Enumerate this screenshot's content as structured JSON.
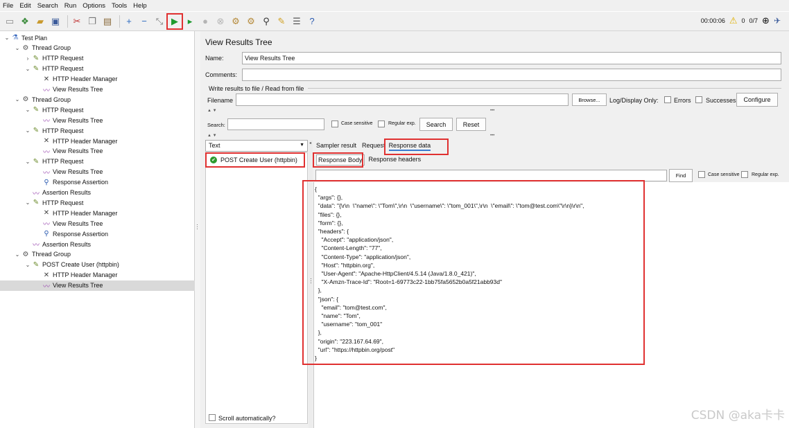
{
  "menu": [
    "File",
    "Edit",
    "Search",
    "Run",
    "Options",
    "Tools",
    "Help"
  ],
  "toolbar": {
    "timer": "00:00:06",
    "warnings": "0",
    "threads": "0/7",
    "icons": [
      "new-icon",
      "templates-icon",
      "open-icon",
      "save-icon",
      "cut-icon",
      "copy-icon",
      "paste-icon",
      "expand-icon",
      "collapse-icon",
      "toggle-icon",
      "start-icon",
      "start-no-pause-icon",
      "stop-icon",
      "shutdown-icon",
      "clear-icon",
      "clear-all-icon",
      "search-icon",
      "reset-search-icon",
      "function-helper-icon",
      "help-icon"
    ]
  },
  "tree": [
    {
      "label": "Test Plan",
      "icon": "test-plan-icon",
      "arrow": "v"
    },
    {
      "label": "Thread Group",
      "icon": "gear-icon",
      "arrow": "v"
    },
    {
      "label": "HTTP Request",
      "icon": "pipette-icon",
      "arrow": ">"
    },
    {
      "label": "HTTP Request",
      "icon": "pipette-icon",
      "arrow": "v"
    },
    {
      "label": "HTTP Header Manager",
      "icon": "tools-icon",
      "arrow": ""
    },
    {
      "label": "View Results Tree",
      "icon": "graph-icon",
      "arrow": ""
    },
    {
      "label": "Thread Group",
      "icon": "gear-icon",
      "arrow": "v"
    },
    {
      "label": "HTTP Request",
      "icon": "pipette-icon",
      "arrow": "v"
    },
    {
      "label": "View Results Tree",
      "icon": "graph-icon",
      "arrow": ""
    },
    {
      "label": "HTTP Request",
      "icon": "pipette-icon",
      "arrow": "v"
    },
    {
      "label": "HTTP Header Manager",
      "icon": "tools-icon",
      "arrow": ""
    },
    {
      "label": "View Results Tree",
      "icon": "graph-icon",
      "arrow": ""
    },
    {
      "label": "HTTP Request",
      "icon": "pipette-icon",
      "arrow": "v"
    },
    {
      "label": "View Results Tree",
      "icon": "graph-icon",
      "arrow": ""
    },
    {
      "label": "Response Assertion",
      "icon": "magnifier-icon",
      "arrow": ""
    },
    {
      "label": "Assertion Results",
      "icon": "graph-icon",
      "arrow": ""
    },
    {
      "label": "HTTP Request",
      "icon": "pipette-icon",
      "arrow": "v"
    },
    {
      "label": "HTTP Header Manager",
      "icon": "tools-icon",
      "arrow": ""
    },
    {
      "label": "View Results Tree",
      "icon": "graph-icon",
      "arrow": ""
    },
    {
      "label": "Response Assertion",
      "icon": "magnifier-icon",
      "arrow": ""
    },
    {
      "label": "Assertion Results",
      "icon": "graph-icon",
      "arrow": ""
    },
    {
      "label": "Thread Group",
      "icon": "gear-icon",
      "arrow": "v"
    },
    {
      "label": "POST Create User (httpbin)",
      "icon": "pipette-icon",
      "arrow": "v"
    },
    {
      "label": "HTTP Header Manager",
      "icon": "tools-icon",
      "arrow": ""
    },
    {
      "label": "View Results Tree",
      "icon": "graph-icon",
      "arrow": "",
      "selected": true
    }
  ],
  "panel": {
    "title": "View Results Tree",
    "name_label": "Name:",
    "name_value": "View Results Tree",
    "comments_label": "Comments:",
    "comments_value": "",
    "write_results": "Write results to file / Read from file",
    "filename_label": "Filename",
    "filename_value": "",
    "browse": "Browse...",
    "log_display": "Log/Display Only:",
    "errors": "Errors",
    "successes": "Successes",
    "configure": "Configure",
    "search_label": "Search:",
    "search_value": "",
    "case_sensitive": "Case sensitive",
    "regular_exp": "Regular exp.",
    "search_btn": "Search",
    "reset_btn": "Reset",
    "renderer": "Text",
    "result_item": "POST Create User (httpbin)",
    "tab_sampler": "Sampler result",
    "tab_request": "Request",
    "tab_response": "Response data",
    "subtab_body": "Response Body",
    "subtab_headers": "Response headers",
    "find_btn": "Find",
    "find_case": "Case sensitive",
    "find_regex": "Regular exp.",
    "scroll_auto": "Scroll automatically?"
  },
  "response_json": [
    "{",
    "  \"args\": {},",
    "  \"data\": \"{\\r\\n  \\\"name\\\": \\\"Tom\\\",\\r\\n  \\\"username\\\": \\\"tom_001\\\",\\r\\n  \\\"email\\\": \\\"tom@test.com\\\"\\r\\n}\\r\\n\",",
    "  \"files\": {},",
    "  \"form\": {},",
    "  \"headers\": {",
    "    \"Accept\": \"application/json\",",
    "    \"Content-Length\": \"77\",",
    "    \"Content-Type\": \"application/json\",",
    "    \"Host\": \"httpbin.org\",",
    "    \"User-Agent\": \"Apache-HttpClient/4.5.14 (Java/1.8.0_421)\",",
    "    \"X-Amzn-Trace-Id\": \"Root=1-69773c22-1bb75fa5652b0a5f21abb93d\"",
    "  },",
    "  \"json\": {",
    "    \"email\": \"tom@test.com\",",
    "    \"name\": \"Tom\",",
    "    \"username\": \"tom_001\"",
    "  },",
    "  \"origin\": \"223.167.64.69\",",
    "  \"url\": \"https://httpbin.org/post\"",
    "}"
  ],
  "watermark": "CSDN @aka卡卡",
  "colors": {
    "highlight": "#e03030",
    "selected_row": "#d9d9d9",
    "success": "#2e9a2e"
  }
}
